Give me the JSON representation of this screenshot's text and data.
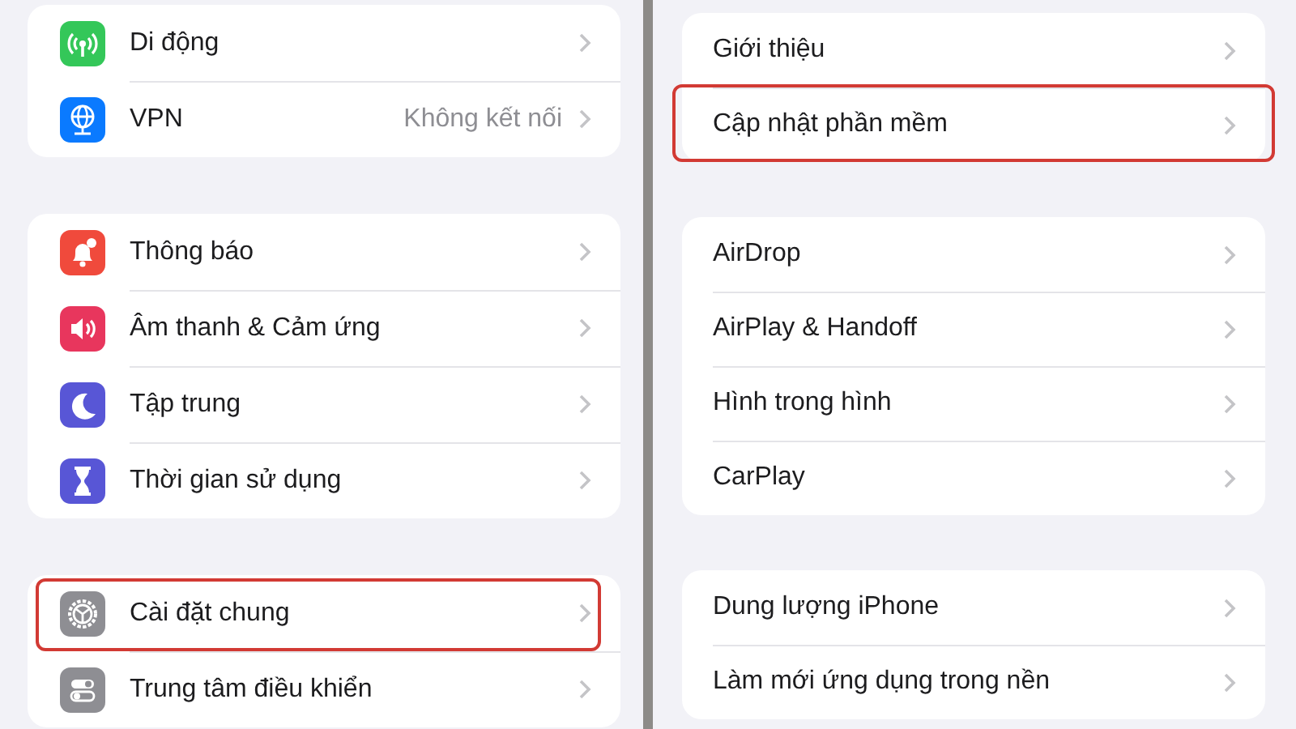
{
  "left_panel": {
    "groups": [
      {
        "rows": [
          {
            "kind": "cellular",
            "label": "Di động",
            "highlighted": false
          },
          {
            "kind": "vpn",
            "label": "VPN",
            "detail": "Không kết nối",
            "highlighted": false
          }
        ]
      },
      {
        "rows": [
          {
            "kind": "bell",
            "label": "Thông báo",
            "highlighted": false
          },
          {
            "kind": "sound",
            "label": "Âm thanh & Cảm ứng",
            "highlighted": false
          },
          {
            "kind": "moon",
            "label": "Tập trung",
            "highlighted": false
          },
          {
            "kind": "hourglass",
            "label": "Thời gian sử dụng",
            "highlighted": false
          }
        ]
      },
      {
        "rows": [
          {
            "kind": "gear",
            "label": "Cài đặt chung",
            "highlighted": true
          },
          {
            "kind": "toggles",
            "label": "Trung tâm điều khiển",
            "highlighted": false
          }
        ]
      }
    ]
  },
  "right_panel": {
    "groups": [
      {
        "rows": [
          {
            "label": "Giới thiệu",
            "highlighted": false
          },
          {
            "label": "Cập nhật phần mềm",
            "highlighted": true
          }
        ]
      },
      {
        "rows": [
          {
            "label": "AirDrop",
            "highlighted": false
          },
          {
            "label": "AirPlay & Handoff",
            "highlighted": false
          },
          {
            "label": "Hình trong hình",
            "highlighted": false
          },
          {
            "label": "CarPlay",
            "highlighted": false
          }
        ]
      },
      {
        "rows": [
          {
            "label": "Dung lượng iPhone",
            "highlighted": false
          },
          {
            "label": "Làm mới ứng dụng trong nền",
            "highlighted": false
          }
        ]
      }
    ]
  }
}
